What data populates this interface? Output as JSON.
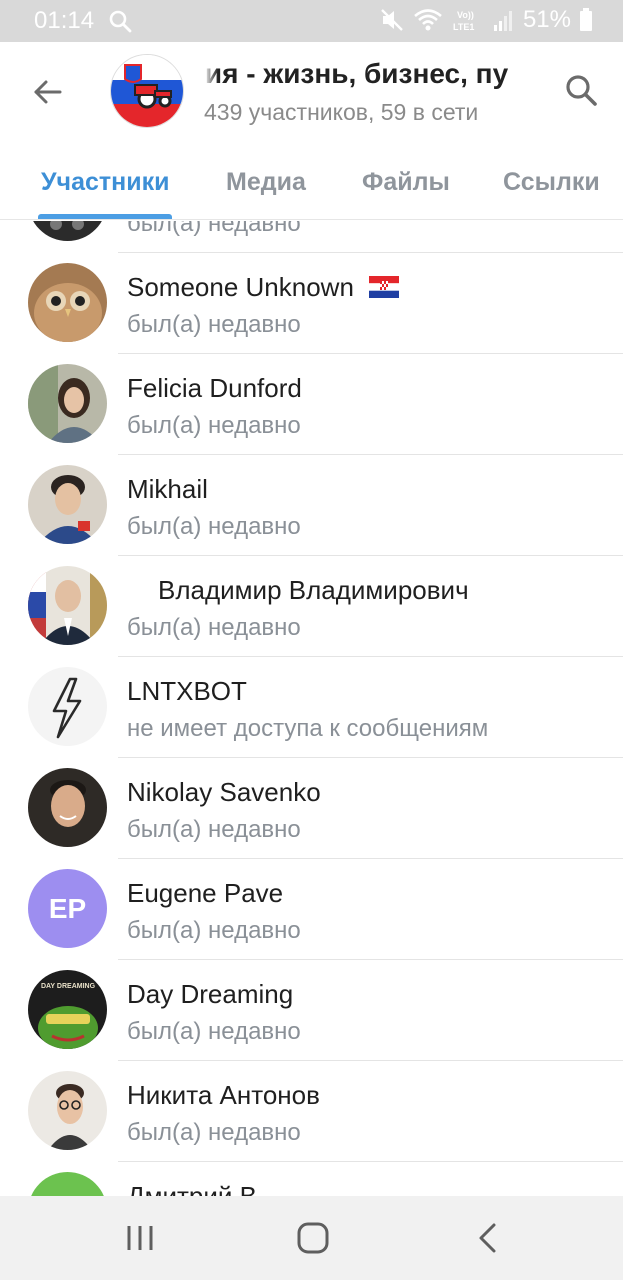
{
  "status_bar": {
    "time": "01:14",
    "battery_percent": "51%",
    "icons": [
      "search-icon",
      "mute-icon",
      "wifi-icon",
      "volte-lte-icon",
      "signal-icon",
      "battery-icon"
    ],
    "volte_label": "Vo)) LTE1"
  },
  "header": {
    "title": "ния - жизнь, бизнес, пу",
    "subtitle": "439 участников, 59 в сети",
    "back_icon": "arrow-left-icon",
    "search_icon": "search-icon",
    "avatar_icon": "slovenia-flag-tractor-avatar"
  },
  "tabs": [
    {
      "label": "Участники",
      "active": true
    },
    {
      "label": "Медиа",
      "active": false
    },
    {
      "label": "Файлы",
      "active": false
    },
    {
      "label": "Ссылки",
      "active": false
    }
  ],
  "members": [
    {
      "name": "",
      "status": "был(а) недавно",
      "avatar": "dark-photo-avatar"
    },
    {
      "name": "Someone Unknown",
      "flag": "🇭🇷",
      "status": "был(а) недавно",
      "avatar": "owl-photo-avatar"
    },
    {
      "name": "Felicia Dunford",
      "status": "был(а) недавно",
      "avatar": "woman-photo-avatar"
    },
    {
      "name": "Mikhail",
      "status": "был(а) недавно",
      "avatar": "man-photo-avatar"
    },
    {
      "name": "Владимир Владимирович",
      "status": "был(а) недавно",
      "avatar": "man-suit-photo-avatar"
    },
    {
      "name": "LNTXBOT",
      "status": "не имеет доступа к сообщениям",
      "avatar": "lightning-icon"
    },
    {
      "name": "Nikolay Savenko",
      "status": "был(а) недавно",
      "avatar": "man-photo-avatar"
    },
    {
      "name": "Eugene Pave",
      "status": "был(а) недавно",
      "avatar_initials": "EP",
      "avatar_color": "#9d8ef0"
    },
    {
      "name": "Day Dreaming",
      "status": "был(а) недавно",
      "avatar": "frog-art-avatar",
      "avatar_text": "DAY DREAMING"
    },
    {
      "name": "Никита Антонов",
      "status": "был(а) недавно",
      "avatar": "man-glasses-photo-avatar"
    },
    {
      "name": "Дмитрий В",
      "status": "",
      "avatar_color": "#6cc24f"
    }
  ],
  "nav_bar": {
    "icons": [
      "recent-apps-icon",
      "home-icon",
      "back-icon"
    ]
  },
  "colors": {
    "accent": "#3d8fd6",
    "tab_indicator": "#4c9ee4",
    "status_text": "#8a9097"
  }
}
